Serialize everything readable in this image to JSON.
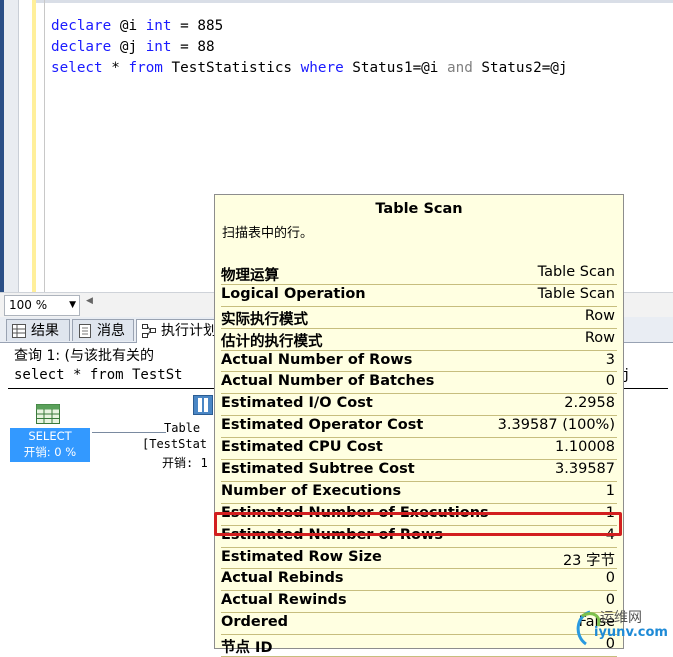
{
  "editor": {
    "lines": [
      {
        "kw1": "declare",
        "text": " @i ",
        "kw2": "int",
        "rest": " = 885"
      },
      {
        "kw1": "declare",
        "text": " @j ",
        "kw2": "int",
        "rest": " = 88"
      },
      {
        "kw1": "select",
        "a": " * ",
        "kw2": "from",
        "b": " TestStatistics ",
        "kw3": "where",
        "c": " Status1=@i ",
        "kw4": "and",
        "d": " Status2=@j"
      }
    ]
  },
  "zoom": {
    "value": "100 %"
  },
  "tabs": [
    {
      "label": "结果"
    },
    {
      "label": "消息"
    },
    {
      "label": "执行计划"
    }
  ],
  "plan": {
    "query_header": "查询 1: (与该批有关的",
    "query_sql": "select * from TestSt",
    "query_sql_tail": "j",
    "select_node": {
      "label": "SELECT",
      "cost": "开销: 0 %"
    },
    "table_node": {
      "line1": "Table",
      "line2": "[TestStat",
      "line3": "开销: 1"
    }
  },
  "tooltip": {
    "title": "Table Scan",
    "description": "扫描表中的行。",
    "rows": [
      {
        "key": "物理运算",
        "value": "Table Scan"
      },
      {
        "key": "Logical Operation",
        "value": "Table Scan"
      },
      {
        "key": "实际执行模式",
        "value": "Row"
      },
      {
        "key": "估计的执行模式",
        "value": "Row"
      },
      {
        "key": "Actual Number of Rows",
        "value": "3"
      },
      {
        "key": "Actual Number of Batches",
        "value": "0"
      },
      {
        "key": "Estimated I/O Cost",
        "value": "2.2958"
      },
      {
        "key": "Estimated Operator Cost",
        "value": "3.39587 (100%)"
      },
      {
        "key": "Estimated CPU Cost",
        "value": "1.10008"
      },
      {
        "key": "Estimated Subtree Cost",
        "value": "3.39587"
      },
      {
        "key": "Number of Executions",
        "value": "1"
      },
      {
        "key": "Estimated Number of Executions",
        "value": "1"
      },
      {
        "key": "Estimated Number of Rows",
        "value": "4"
      },
      {
        "key": "Estimated Row Size",
        "value": "23 字节"
      },
      {
        "key": "Actual Rebinds",
        "value": "0"
      },
      {
        "key": "Actual Rewinds",
        "value": "0"
      },
      {
        "key": "Ordered",
        "value": "False"
      },
      {
        "key": "节点 ID",
        "value": "0"
      }
    ]
  },
  "watermark": {
    "line1": "运维网",
    "line2": "iyunv.com"
  },
  "colors": {
    "keyword": "#1a1aff",
    "highlight": "#d21f1f",
    "tooltip_bg": "#ffffe1",
    "select_node": "#3399ff"
  }
}
